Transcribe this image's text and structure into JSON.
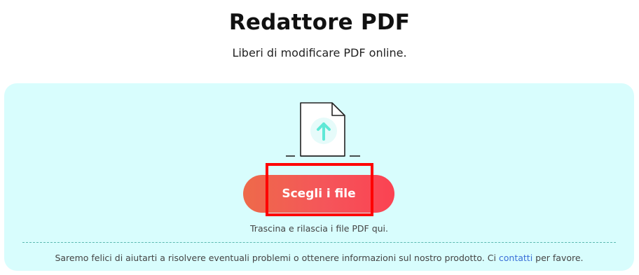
{
  "header": {
    "title": "Redattore PDF",
    "subtitle": "Liberi di modificare PDF online."
  },
  "upload": {
    "icon": "file-upload-icon",
    "button_label": "Scegli i file",
    "drag_hint": "Trascina e rilascia i file PDF qui."
  },
  "footer": {
    "help_before": "Saremo felici di aiutarti a risolvere eventuali problemi o ottenere informazioni sul nostro prodotto. Ci ",
    "contact_link": "contatti",
    "help_after": " per favore."
  },
  "colors": {
    "dropzone_bg": "#d8fdfd",
    "button_gradient_start": "#ee6a4a",
    "button_gradient_end": "#fb4252",
    "highlight": "#ff0000",
    "link": "#3a6fd8",
    "upload_arrow": "#5fe8d6"
  }
}
